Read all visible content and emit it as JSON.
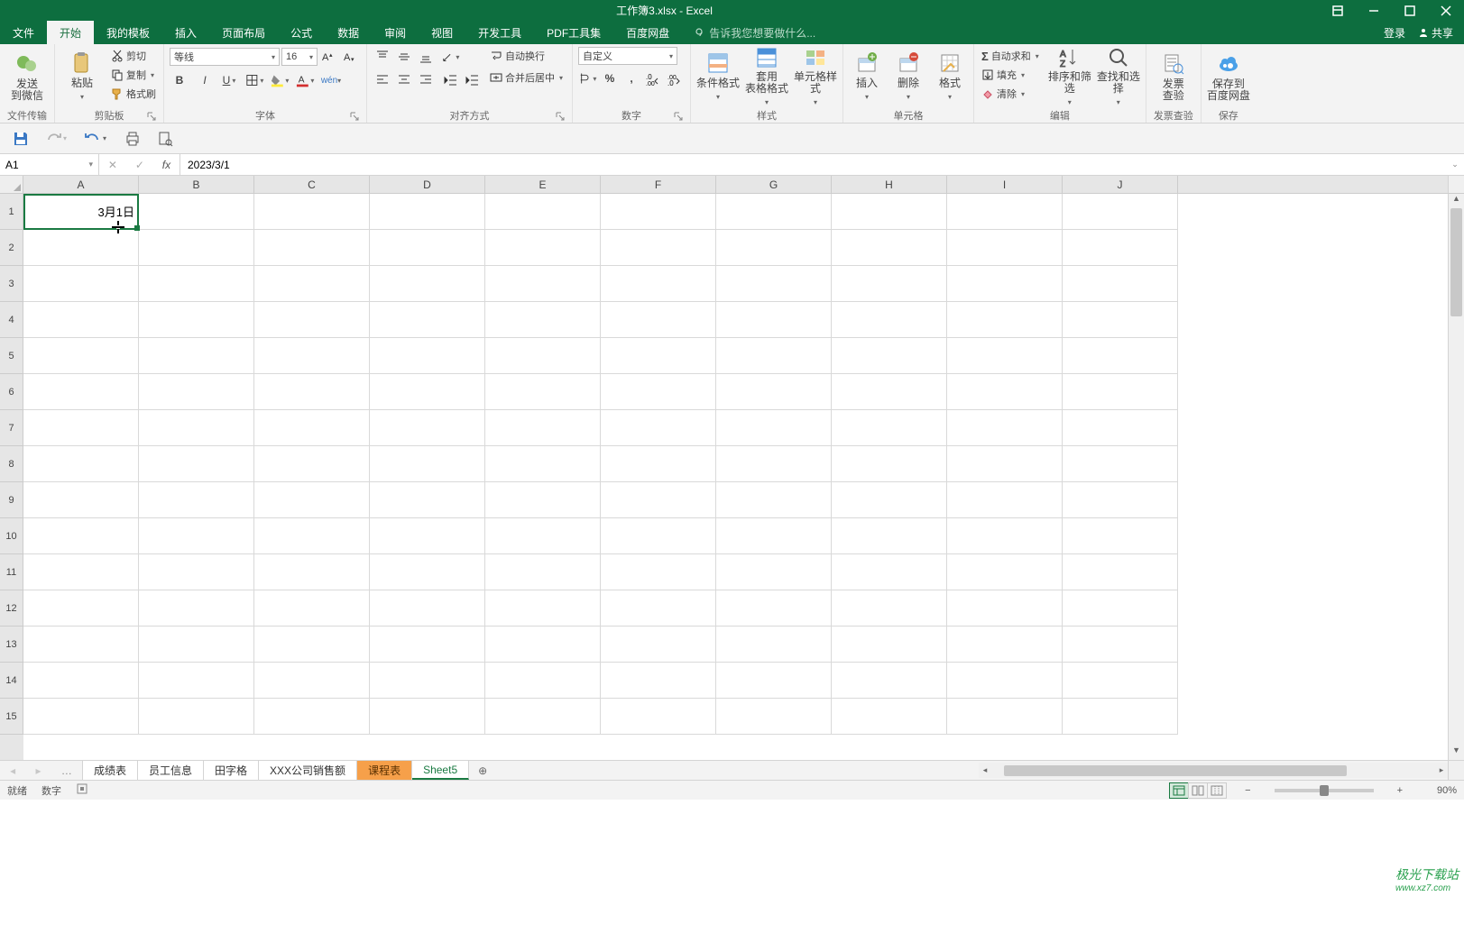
{
  "title": {
    "filename": "工作簿3.xlsx",
    "app": "Excel"
  },
  "tabs": {
    "file": "文件",
    "home": "开始",
    "my_templates": "我的模板",
    "insert": "插入",
    "page_layout": "页面布局",
    "formulas": "公式",
    "data": "数据",
    "review": "审阅",
    "view": "视图",
    "developer": "开发工具",
    "pdf_tools": "PDF工具集",
    "baidu": "百度网盘",
    "tell_me": "告诉我您想要做什么...",
    "login": "登录",
    "share": "共享"
  },
  "ribbon": {
    "send_wechat": "发送\n到微信",
    "paste_label": "粘贴",
    "cut": "剪切",
    "copy": "复制",
    "format_painter": "格式刷",
    "group_file": "文件传输",
    "group_clipboard": "剪贴板",
    "font_name": "等线",
    "font_size": "16",
    "wen": "wén",
    "group_font": "字体",
    "wrap_text": "自动换行",
    "merge_center": "合并后居中",
    "group_align": "对齐方式",
    "number_format": "自定义",
    "group_number": "数字",
    "cond_fmt": "条件格式",
    "table_fmt": "套用\n表格格式",
    "cell_style": "单元格样式",
    "group_styles": "样式",
    "insert": "插入",
    "delete": "删除",
    "format": "格式",
    "group_cells": "单元格",
    "autosum": "自动求和",
    "fill": "填充",
    "clear": "清除",
    "sort_filter": "排序和筛选",
    "find_select": "查找和选择",
    "group_edit": "编辑",
    "invoice": "发票\n查验",
    "group_invoice": "发票查验",
    "save_baidu": "保存到\n百度网盘",
    "group_save": "保存"
  },
  "formula_bar": {
    "cell_ref": "A1",
    "fx": "fx",
    "value": "2023/3/1"
  },
  "grid": {
    "columns": [
      "A",
      "B",
      "C",
      "D",
      "E",
      "F",
      "G",
      "H",
      "I",
      "J"
    ],
    "row_numbers": [
      "1",
      "2",
      "3",
      "4",
      "5",
      "6",
      "7",
      "8",
      "9",
      "10",
      "11",
      "12",
      "13",
      "14",
      "15"
    ],
    "A1": "3月1日"
  },
  "sheet_tabs": {
    "t1": "成绩表",
    "t2": "员工信息",
    "t3": "田字格",
    "t4": "XXX公司销售额",
    "t5": "课程表",
    "t6": "Sheet5"
  },
  "status": {
    "ready": "就绪",
    "mode": "数字",
    "zoom_label": "90%",
    "minus": "−",
    "plus": "+"
  },
  "watermark": {
    "line1": "极光下载站",
    "line2": "www.xz7.com"
  }
}
